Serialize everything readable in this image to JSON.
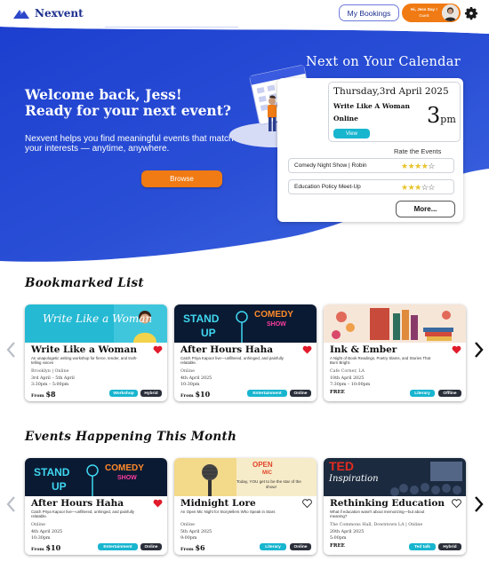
{
  "nav": {
    "brand": "Nexvent",
    "bookings_label": "My Bookings",
    "greeting": "Hi, Jess Day !",
    "user_role": "Guest"
  },
  "hero": {
    "welcome_line1": "Welcome back, Jess!",
    "welcome_line2": "Ready for your next event?",
    "intro": "Nexvent helps you find meaningful events that match your interests — anytime, anywhere.",
    "browse_label": "Browse"
  },
  "calendar": {
    "title": "Next on Your Calendar",
    "next": {
      "date": "Thursday,3rd April 2025",
      "name": "Write Like A Woman",
      "mode": "Online",
      "time_number": "3",
      "time_suffix": "pm",
      "view_label": "View"
    },
    "rate_title": "Rate the Events",
    "ratings": [
      {
        "name": "Comedy Night Show | Robin",
        "stars": 4,
        "max": 5
      },
      {
        "name": "Education Policy Meet-Up",
        "stars": 3,
        "max": 5
      }
    ],
    "more_label": "More..."
  },
  "bookmarked": {
    "title": "Bookmarked List",
    "cards": [
      {
        "title": "Write Like a Woman",
        "desc": "An unapologetic writing workshop for fierce, tender, and truth-telling voices",
        "location": "Brooklyn | Online",
        "date": "3rd April – 5th April",
        "time": "3:30pm – 5:00pm",
        "price_prefix": "From",
        "price": "$8",
        "category": "Workshop",
        "mode": "Hybrid",
        "image_text": "Write Like a Woman",
        "bookmarked": true
      },
      {
        "title": "After Hours Haha",
        "desc": "Catch Priya Kapoor live—unfiltered, unhinged, and painfully relatable.",
        "location": "Online",
        "date": "4th April 2025",
        "time": "10:30pm",
        "price_prefix": "From",
        "price": "$10",
        "category": "Entertainment",
        "mode": "Online",
        "image_text": "STAND UP COMEDY SHOW",
        "bookmarked": true
      },
      {
        "title": "Ink & Ember",
        "desc": "A Night of Book Readings, Poetry Slams, and Stories That Burn Bright.",
        "location": "Cafe Corner, LA",
        "date": "10th April 2025",
        "time": "7:30pm – 10:00pm",
        "price_prefix": "",
        "price": "FREE",
        "category": "Literary",
        "mode": "Offline",
        "image_text": "",
        "bookmarked": true
      }
    ]
  },
  "this_month": {
    "title": "Events Happening This Month",
    "cards": [
      {
        "title": "After Hours Haha",
        "desc": "Catch Priya Kapoor live—unfiltered, unhinged, and painfully relatable.",
        "location": "Online",
        "date": "4th April 2025",
        "time": "10:30pm",
        "price_prefix": "From",
        "price": "$10",
        "category": "Entertainment",
        "mode": "Online",
        "image_text": "STAND UP COMEDY SHOW",
        "bookmarked": true
      },
      {
        "title": "Midnight Lore",
        "desc": "An Open Mic Night for Storytellers Who Speak in Stars",
        "location": "Online",
        "date": "5th April 2025",
        "time": "9:00pm",
        "price_prefix": "From",
        "price": "$6",
        "category": "Literary",
        "mode": "Online",
        "image_text": "OPEN MIC Today, YOU get to be the star of the show!",
        "bookmarked": false
      },
      {
        "title": "Rethinking Education",
        "desc": "What if education wasn't about memorizing—but about meaning?",
        "location": "The Commons Hall, Downtown LA | Online",
        "date": "20th April 2025",
        "time": "5:00pm",
        "price_prefix": "",
        "price": "FREE",
        "category": "Ted talk",
        "mode": "Hybrid",
        "image_text": "TED Inspiration",
        "bookmarked": false
      }
    ]
  },
  "colors": {
    "hero_blue": "#1f43cf",
    "accent_orange": "#f07a13",
    "tag_cyan": "#18b5cf",
    "heart_red": "#e11b2b",
    "star_gold": "#e8c42a"
  }
}
